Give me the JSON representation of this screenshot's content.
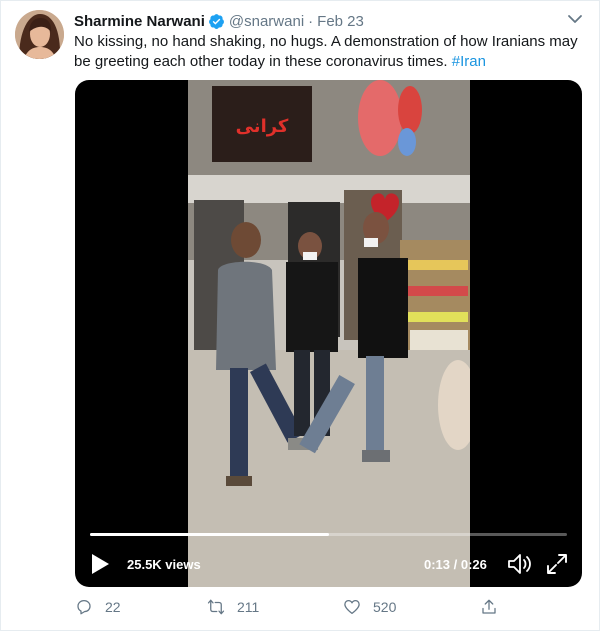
{
  "tweet": {
    "author_name": "Sharmine Narwani",
    "handle": "@snarwani",
    "separator": "·",
    "date": "Feb 23",
    "text": "No kissing, no hand shaking, no hugs. A demonstration of how Iranians may be greeting each other today in these coronavirus times.",
    "hashtag": "#Iran"
  },
  "video": {
    "views": "25.5K views",
    "time": "0:13 / 0:26",
    "progress": 0.5
  },
  "actions": {
    "replies": "22",
    "retweets": "211",
    "likes": "520"
  },
  "storefront": {
    "sign": "کرانی"
  },
  "colors": {
    "link": "#1b95e0",
    "muted": "#657786",
    "verified": "#1da1f2"
  },
  "icons": [
    "verified-icon",
    "caret-down-icon",
    "play-icon",
    "volume-icon",
    "fullscreen-icon",
    "reply-icon",
    "retweet-icon",
    "like-icon",
    "share-icon"
  ]
}
